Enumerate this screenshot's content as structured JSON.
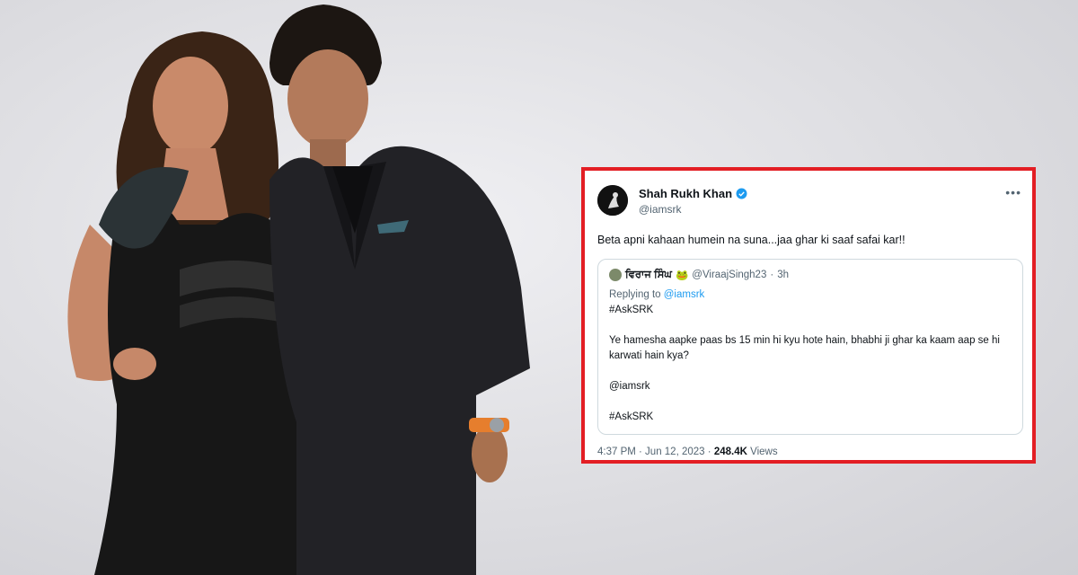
{
  "tweet": {
    "display_name": "Shah Rukh Khan",
    "handle": "@iamsrk",
    "more_icon": "more-horizontal-icon",
    "verified_icon": "verified-badge-icon",
    "text": "Beta apni kahaan humein na suna...jaa ghar ki saaf safai kar!!",
    "timestamp": "4:37 PM · Jun 12, 2023",
    "separator": "·",
    "views_count": "248.4K",
    "views_label": "Views"
  },
  "quote": {
    "name": "ਵਿਰਾਜ ਸਿੰਘ",
    "name_emoji": "🐸",
    "handle": "@ViraajSingh23",
    "dot": "·",
    "time": "3h",
    "replying_prefix": "Replying to",
    "replying_handle": "@iamsrk",
    "hashtag1": "#AskSRK",
    "question": "Ye hamesha aapke paas bs 15 min hi kyu hote hain, bhabhi ji ghar ka kaam aap se hi karwati hain kya?",
    "mention": "@iamsrk",
    "hashtag2": "#AskSRK"
  },
  "colors": {
    "frame_border": "#e31e24",
    "link_blue": "#1d9bf0",
    "muted_text": "#536471",
    "primary_text": "#0f1419"
  }
}
